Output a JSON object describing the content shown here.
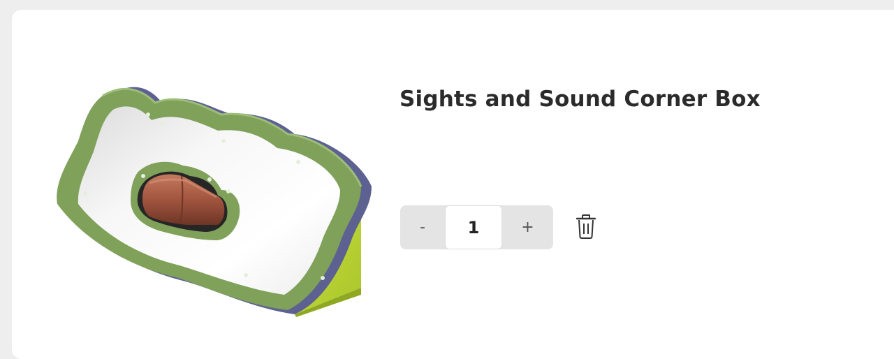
{
  "product": {
    "title": "Sights and Sound Corner Box",
    "quantity": "1"
  },
  "quantity_control": {
    "decrement_label": "-",
    "increment_label": "+"
  },
  "icons": {
    "delete": "trash-icon"
  },
  "colors": {
    "page_background": "#eeeeee",
    "card_background": "#ffffff",
    "title_text": "#2b2b2b",
    "stepper_background": "#e4e4e4",
    "frame_green": "#7fa15a",
    "frame_back_blue": "#5d6191",
    "base_lime": "#b8d333",
    "roller_brown": "#a45a43"
  }
}
